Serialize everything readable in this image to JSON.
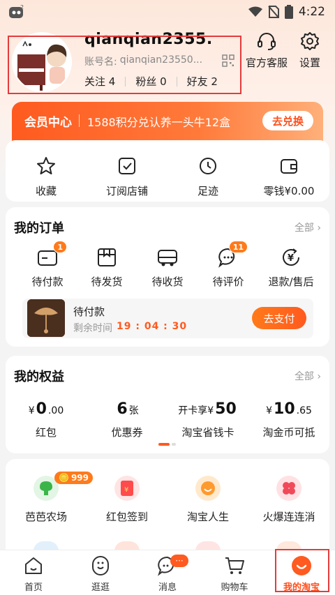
{
  "status_bar": {
    "time": "4:22"
  },
  "profile": {
    "username": "qianqian2355.",
    "account_label": "账号名:",
    "account_value": "qianqian23550...",
    "follow": "关注 4",
    "fans": "粉丝 0",
    "friends": "好友 2"
  },
  "header_actions": {
    "service": "官方客服",
    "settings": "设置"
  },
  "member": {
    "title": "会员中心",
    "desc": "1588积分兑认养一头牛12盒",
    "button": "去兑换"
  },
  "quick_links": [
    {
      "label": "收藏",
      "icon": "star-icon"
    },
    {
      "label": "订阅店铺",
      "icon": "checkbox-icon"
    },
    {
      "label": "足迹",
      "icon": "clock-icon"
    },
    {
      "label": "零钱¥0.00",
      "icon": "wallet-icon"
    }
  ],
  "orders": {
    "title": "我的订单",
    "more": "全部",
    "items": [
      {
        "label": "待付款",
        "badge": "1",
        "icon": "card-icon"
      },
      {
        "label": "待发货",
        "badge": "",
        "icon": "package-icon"
      },
      {
        "label": "待收货",
        "badge": "",
        "icon": "truck-icon"
      },
      {
        "label": "待评价",
        "badge": "11",
        "icon": "chat-icon"
      },
      {
        "label": "退款/售后",
        "badge": "",
        "icon": "refund-icon"
      }
    ],
    "pending": {
      "title": "待付款",
      "timer_label": "剩余时间",
      "timer_value": "19 : 04 : 30",
      "button": "去支付"
    }
  },
  "rights": {
    "title": "我的权益",
    "more": "全部",
    "items": [
      {
        "prefix": "¥",
        "value": "0",
        "suffix": ".00",
        "label": "红包"
      },
      {
        "prefix": "",
        "value": "6",
        "suffix": "张",
        "label": "优惠券"
      },
      {
        "prefix": "开卡享¥",
        "value": "50",
        "suffix": "",
        "label": "淘宝省钱卡"
      },
      {
        "prefix": "¥",
        "value": "10",
        "suffix": ".65",
        "label": "淘金币可抵"
      }
    ]
  },
  "apps": {
    "items": [
      {
        "label": "芭芭农场",
        "icon": "farm-icon",
        "color": "#3bb54a"
      },
      {
        "label": "红包签到",
        "icon": "red-packet-icon",
        "color": "#ff4b4b"
      },
      {
        "label": "淘宝人生",
        "icon": "taobao-life-icon",
        "color": "#ff9a2e"
      },
      {
        "label": "火爆连连消",
        "icon": "match-game-icon",
        "color": "#f04a5a"
      }
    ],
    "farm_badge": "999"
  },
  "bottom_nav": {
    "items": [
      {
        "label": "首页",
        "icon": "home-icon"
      },
      {
        "label": "逛逛",
        "icon": "explore-icon"
      },
      {
        "label": "消息",
        "icon": "message-icon"
      },
      {
        "label": "购物车",
        "icon": "cart-icon"
      },
      {
        "label": "我的淘宝",
        "icon": "my-taobao-icon"
      }
    ],
    "message_badge": "···"
  },
  "colors": {
    "accent": "#ff5a1f",
    "highlight_box": "#e43b3b"
  }
}
